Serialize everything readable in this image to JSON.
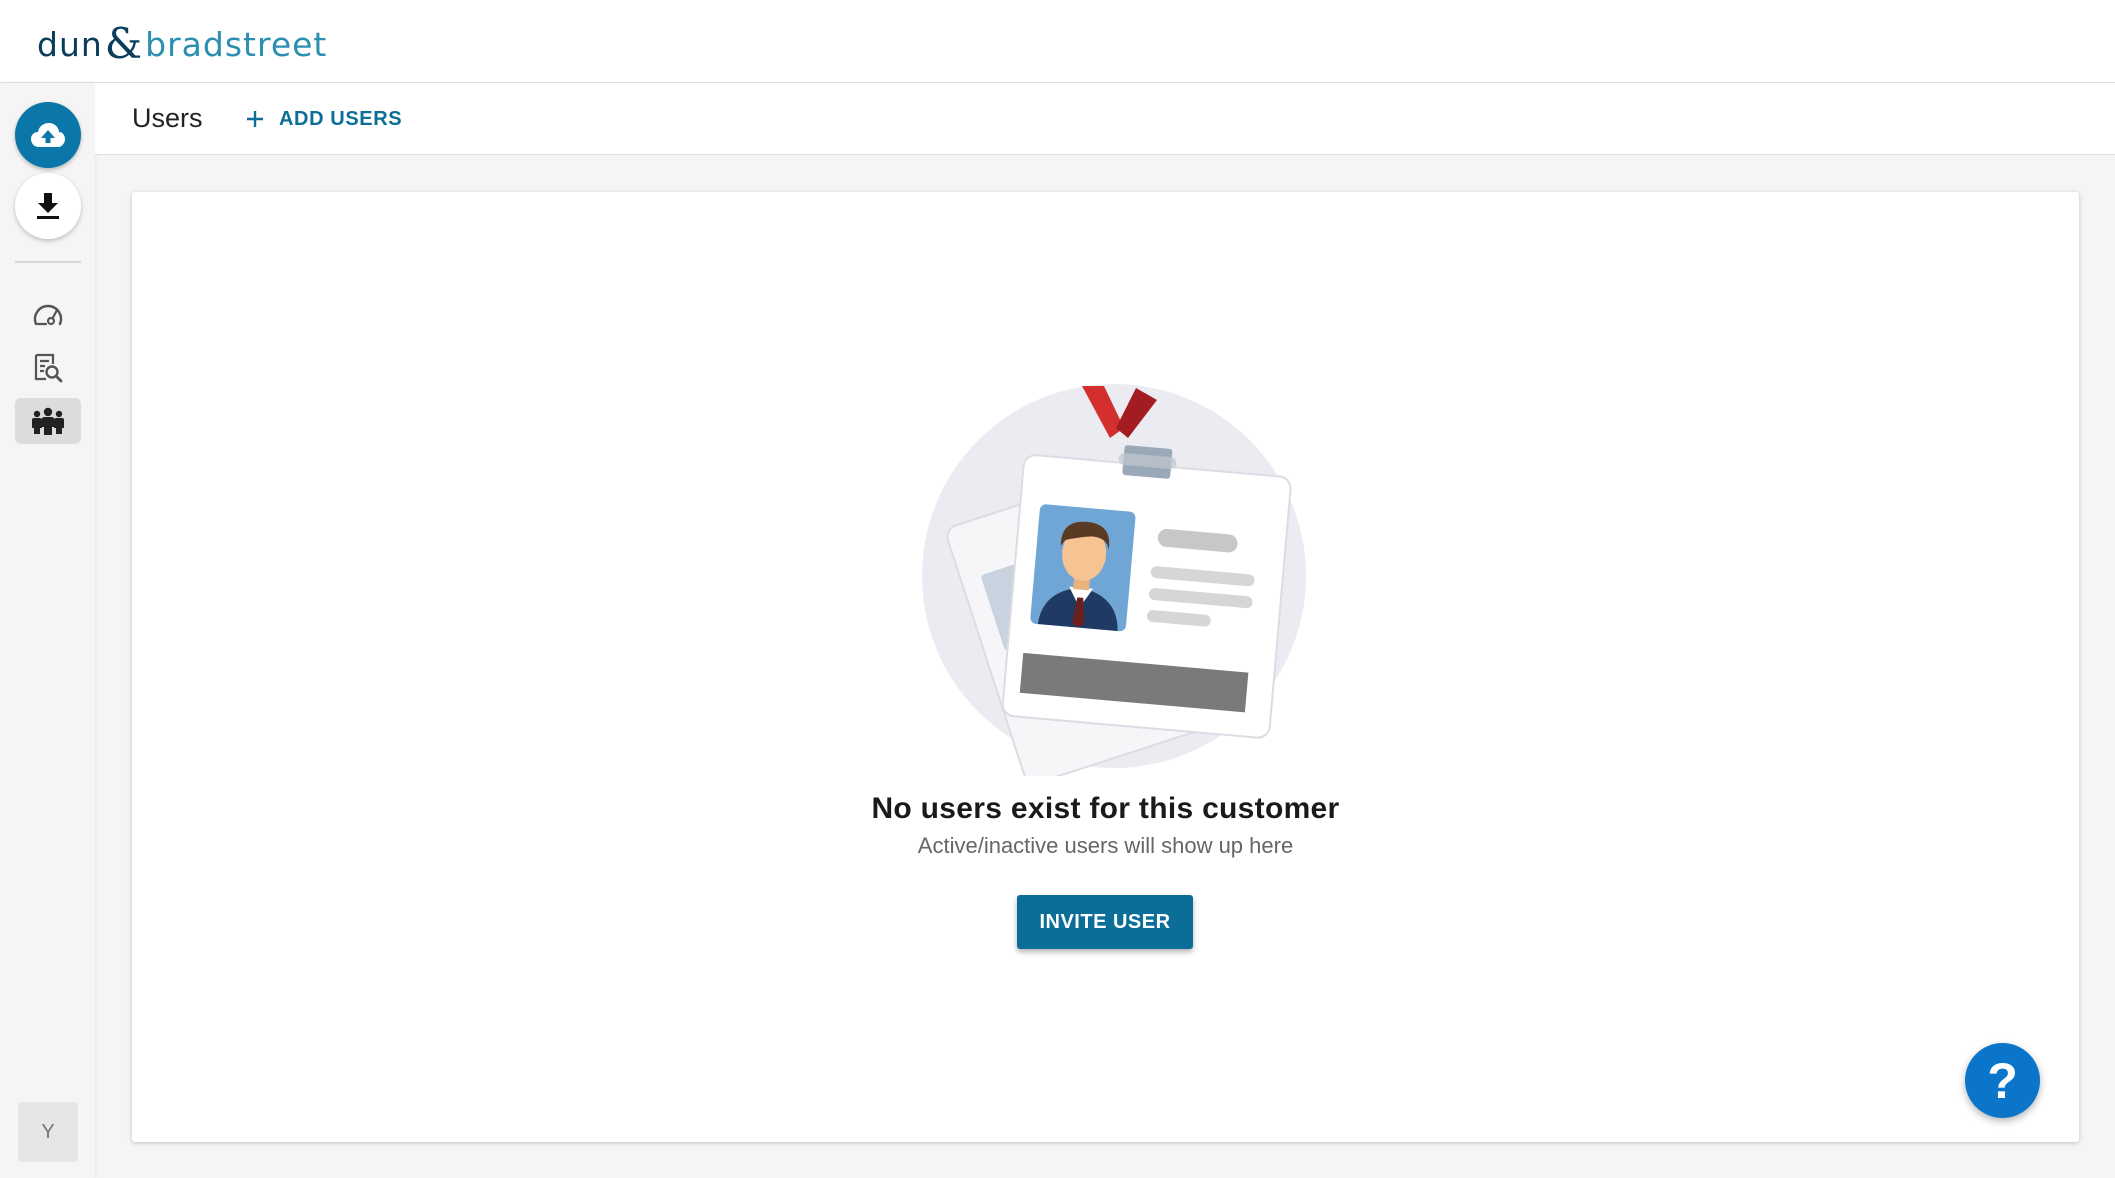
{
  "brand": {
    "part1": "dun",
    "amp": "&",
    "part2": "bradstreet"
  },
  "header": {
    "title": "Users",
    "add_users_label": "ADD USERS"
  },
  "empty_state": {
    "title": "No users exist for this customer",
    "subtitle": "Active/inactive users will show up here",
    "invite_label": "INVITE USER"
  },
  "user": {
    "avatar_initial": "Y"
  },
  "help": {
    "label": "?"
  },
  "icons": {
    "upload": "cloud-upload-icon",
    "download": "download-icon",
    "dashboard": "speedometer-icon",
    "search": "document-search-icon",
    "users": "people-icon",
    "add": "plus-icon"
  },
  "colors": {
    "primary": "#0b6e99",
    "upload_button": "#0b76a8",
    "help_button": "#0b76c9",
    "brand_dark": "#0a3d5c",
    "brand_light": "#2a8fb0"
  }
}
